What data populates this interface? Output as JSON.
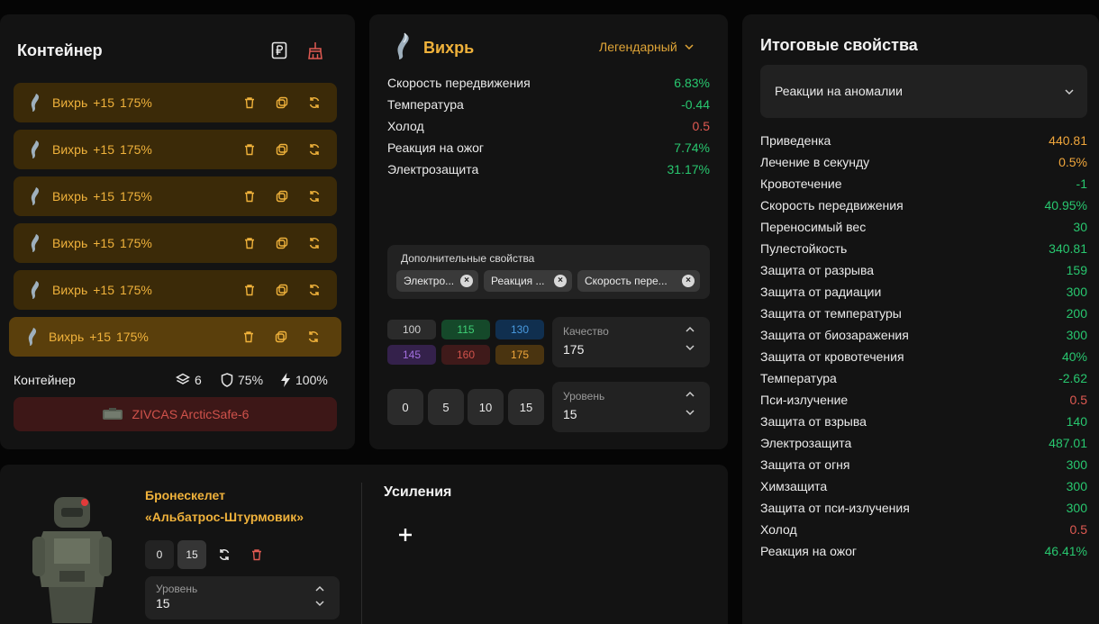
{
  "container": {
    "title": "Контейнер",
    "icons": [
      "ruble-icon",
      "broom-icon"
    ],
    "items": [
      {
        "name": "Вихрь",
        "level": "+15",
        "quality": "175%"
      },
      {
        "name": "Вихрь",
        "level": "+15",
        "quality": "175%"
      },
      {
        "name": "Вихрь",
        "level": "+15",
        "quality": "175%"
      },
      {
        "name": "Вихрь",
        "level": "+15",
        "quality": "175%"
      },
      {
        "name": "Вихрь",
        "level": "+15",
        "quality": "175%"
      },
      {
        "name": "Вихрь",
        "level": "+15",
        "quality": "175%",
        "active": true
      }
    ],
    "footer": {
      "label": "Контейнер",
      "slots": "6",
      "protection": "75%",
      "efficiency": "100%"
    },
    "container_item": "ZIVCAS ArcticSafe-6"
  },
  "artifact": {
    "name": "Вихрь",
    "rarity": "Легендарный",
    "stats": [
      {
        "name": "Скорость передвижения",
        "value": "6.83%",
        "tone": "pos"
      },
      {
        "name": "Температура",
        "value": "-0.44",
        "tone": "pos"
      },
      {
        "name": "Холод",
        "value": "0.5",
        "tone": "neg"
      },
      {
        "name": "Реакция на ожог",
        "value": "7.74%",
        "tone": "pos"
      },
      {
        "name": "Электрозащита",
        "value": "31.17%",
        "tone": "pos"
      }
    ],
    "extra": {
      "title": "Дополнительные свойства",
      "tags": [
        "Электро...",
        "Реакция ...",
        "Скорость пере..."
      ]
    },
    "quality_presets": [
      "100",
      "115",
      "130",
      "145",
      "160",
      "175"
    ],
    "quality": {
      "label": "Качество",
      "value": "175"
    },
    "level_presets": [
      "0",
      "5",
      "10",
      "15"
    ],
    "level": {
      "label": "Уровень",
      "value": "15"
    }
  },
  "summary": {
    "title": "Итоговые свойства",
    "filter": "Реакции на аномалии",
    "rows": [
      {
        "name": "Приведенка",
        "value": "440.81",
        "tone": "org"
      },
      {
        "name": "Лечение в секунду",
        "value": "0.5%",
        "tone": "org"
      },
      {
        "name": "Кровотечение",
        "value": "-1",
        "tone": "pos"
      },
      {
        "name": "Скорость передвижения",
        "value": "40.95%",
        "tone": "pos"
      },
      {
        "name": "Переносимый вес",
        "value": "30",
        "tone": "pos"
      },
      {
        "name": "Пулестойкость",
        "value": "340.81",
        "tone": "pos"
      },
      {
        "name": "Защита от разрыва",
        "value": "159",
        "tone": "pos"
      },
      {
        "name": "Защита от радиации",
        "value": "300",
        "tone": "pos"
      },
      {
        "name": "Защита от температуры",
        "value": "200",
        "tone": "pos"
      },
      {
        "name": "Защита от биозаражения",
        "value": "300",
        "tone": "pos"
      },
      {
        "name": "Защита от кровотечения",
        "value": "40%",
        "tone": "pos"
      },
      {
        "name": "Температура",
        "value": "-2.62",
        "tone": "pos"
      },
      {
        "name": "Пси-излучение",
        "value": "0.5",
        "tone": "neg"
      },
      {
        "name": "Защита от взрыва",
        "value": "140",
        "tone": "pos"
      },
      {
        "name": "Электрозащита",
        "value": "487.01",
        "tone": "pos"
      },
      {
        "name": "Защита от огня",
        "value": "300",
        "tone": "pos"
      },
      {
        "name": "Химзащита",
        "value": "300",
        "tone": "pos"
      },
      {
        "name": "Защита от пси-излучения",
        "value": "300",
        "tone": "pos"
      },
      {
        "name": "Холод",
        "value": "0.5",
        "tone": "neg"
      },
      {
        "name": "Реакция на ожог",
        "value": "46.41%",
        "tone": "pos"
      }
    ]
  },
  "armor": {
    "name_line1": "Бронескелет",
    "name_line2": "«Альбатрос-Штурмовик»",
    "level_presets": [
      "0",
      "15"
    ],
    "level": {
      "label": "Уровень",
      "value": "15"
    },
    "boosts_title": "Усиления"
  },
  "colors": {
    "accent": "#f0b23b",
    "positive": "#28c76f",
    "negative": "#e05a52",
    "orange": "#f0a63b"
  }
}
